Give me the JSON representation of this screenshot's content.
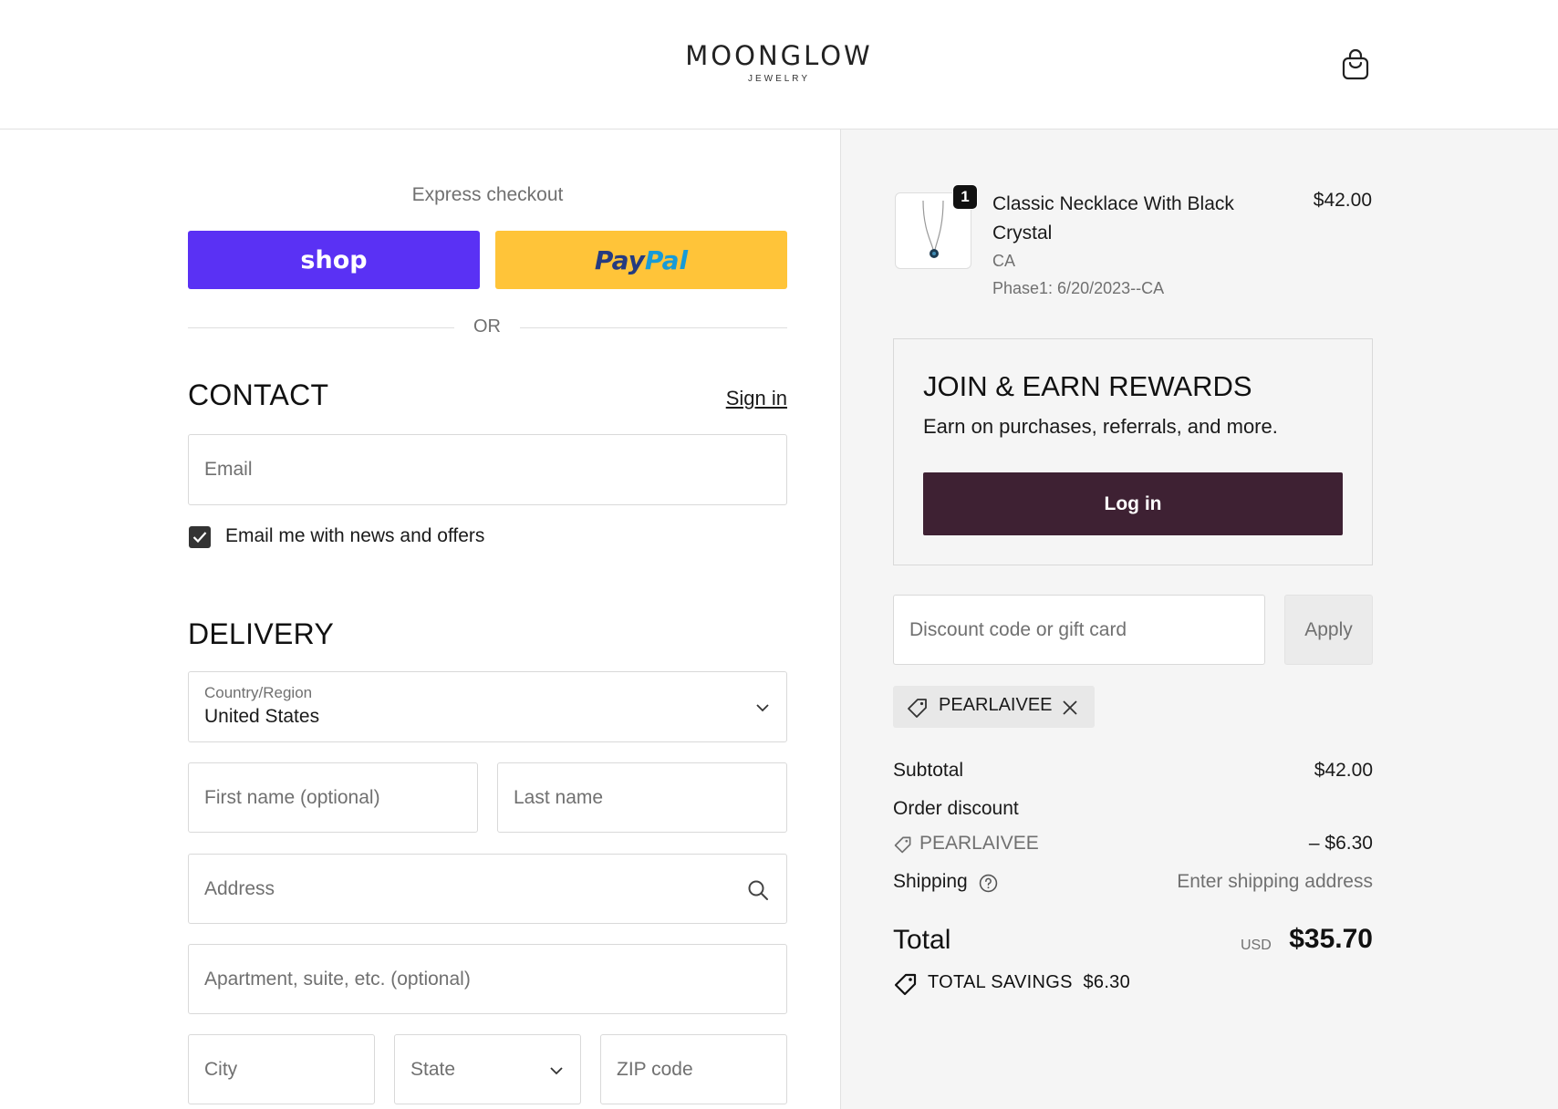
{
  "brand": {
    "name": "MOONGLOW",
    "tagline": "JEWELRY"
  },
  "express": {
    "title": "Express checkout",
    "shop_label": "shop",
    "paypal_part1": "Pay",
    "paypal_part2": "Pal",
    "or_label": "OR"
  },
  "contact": {
    "title": "CONTACT",
    "sign_in": "Sign in",
    "email_placeholder": "Email",
    "newsletter_label": "Email me with news and offers",
    "newsletter_checked": true
  },
  "delivery": {
    "title": "DELIVERY",
    "country_label": "Country/Region",
    "country_value": "United States",
    "first_name_placeholder": "First name (optional)",
    "last_name_placeholder": "Last name",
    "address_placeholder": "Address",
    "apartment_placeholder": "Apartment, suite, etc. (optional)",
    "city_placeholder": "City",
    "state_placeholder": "State",
    "zip_placeholder": "ZIP code"
  },
  "cart": {
    "item": {
      "quantity": "1",
      "name": "Classic Necklace With Black Crystal",
      "price": "$42.00",
      "variant": "CA",
      "note": "Phase1: 6/20/2023--CA"
    }
  },
  "rewards": {
    "title": "JOIN & EARN REWARDS",
    "subtitle": "Earn on purchases, referrals, and more.",
    "button": "Log in"
  },
  "discount": {
    "placeholder": "Discount code or gift card",
    "apply": "Apply",
    "applied_code": "PEARLAIVEE"
  },
  "summary": {
    "subtotal_label": "Subtotal",
    "subtotal_value": "$42.00",
    "order_discount_label": "Order discount",
    "discount_code": "PEARLAIVEE",
    "discount_value": "– $6.30",
    "shipping_label": "Shipping",
    "shipping_value": "Enter shipping address",
    "total_label": "Total",
    "currency": "USD",
    "total_value": "$35.70",
    "savings_label": "TOTAL SAVINGS",
    "savings_value": "$6.30"
  },
  "colors": {
    "shop_pay": "#5a31f4",
    "paypal": "#ffc439",
    "login_button": "#3e2133",
    "panel_bg": "#f5f5f5"
  }
}
